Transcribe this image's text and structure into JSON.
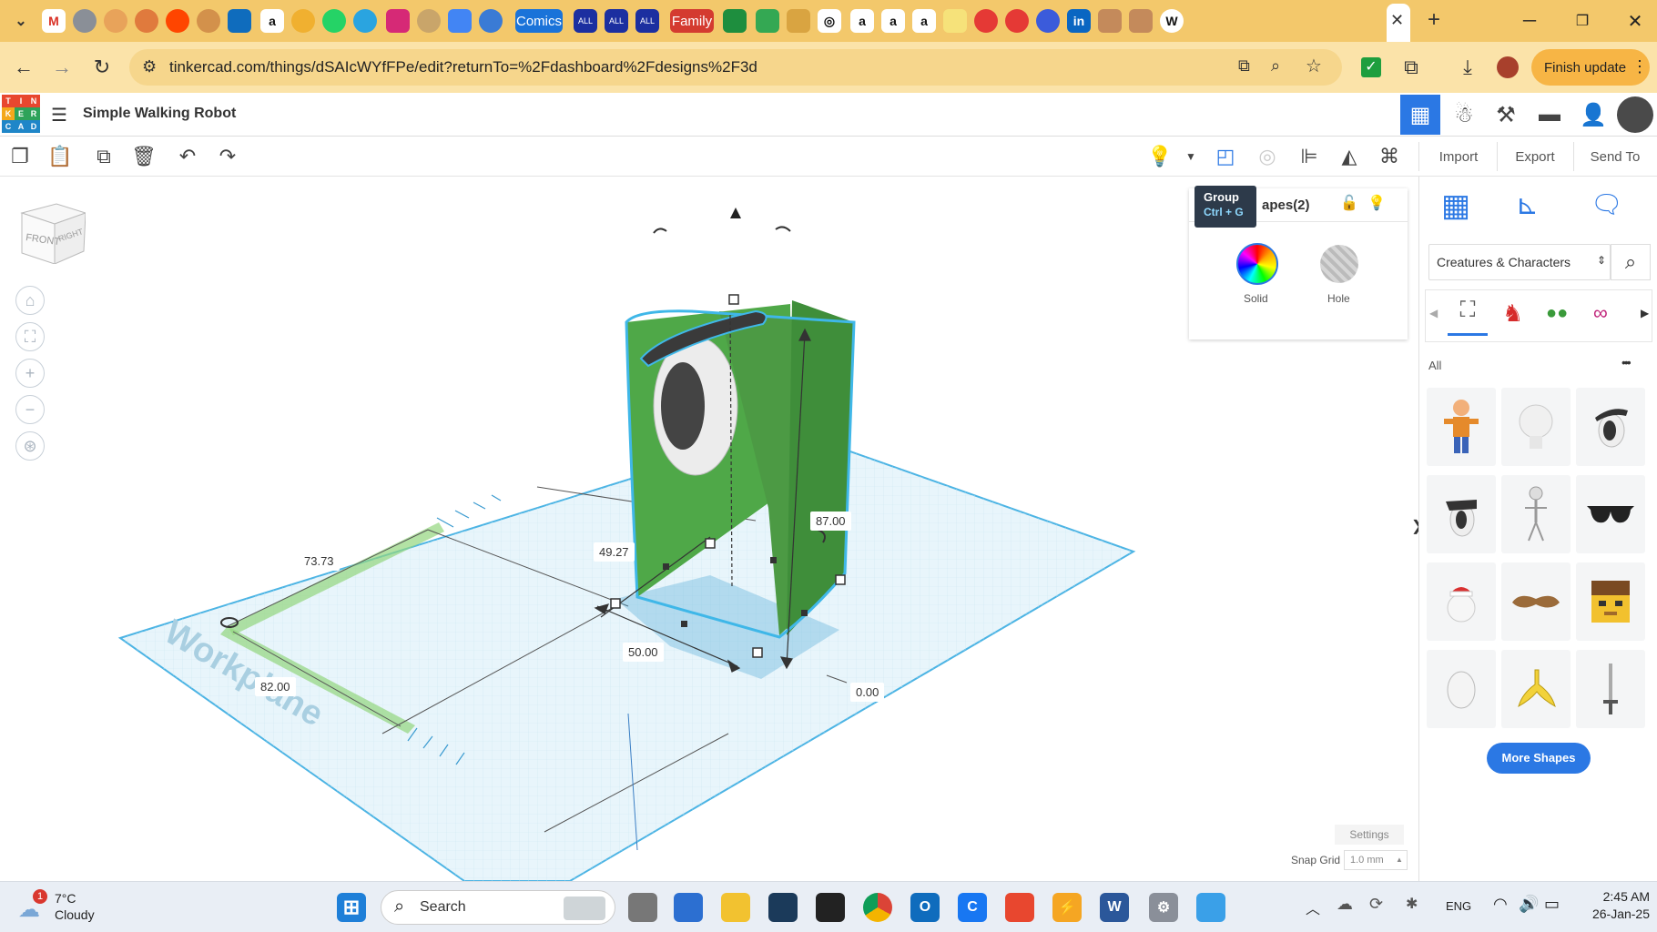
{
  "browser": {
    "tab_labels": [
      "Comics",
      "ALL",
      "ALL",
      "ALL",
      "Family"
    ],
    "url": "tinkercad.com/things/dSAIcWYfFPe/edit?returnTo=%2Fdashboard%2Fdesigns%2F3d",
    "finish_update": "Finish update",
    "menu_dots": "⋮"
  },
  "app": {
    "logo_letters": [
      "T",
      "I",
      "N",
      "K",
      "E",
      "R",
      "C",
      "A",
      "D"
    ],
    "design_title": "Simple Walking Robot"
  },
  "toolbar": {
    "import": "Import",
    "export": "Export",
    "send_to": "Send To"
  },
  "tooltip": {
    "title": "Group",
    "shortcut": "Ctrl + G"
  },
  "inspector": {
    "title": "Shapes(2)",
    "title_visible_part": "apes(2)",
    "solid": "Solid",
    "hole": "Hole"
  },
  "viewcube": {
    "front": "FRONT",
    "right": "RIGHT"
  },
  "workplane": {
    "watermark": "Workplane"
  },
  "dimensions": {
    "width_x": "73.73",
    "depth": "49.27",
    "height": "87.00",
    "length": "50.00",
    "y_offset": "82.00",
    "elevation": "0.00"
  },
  "sidebar": {
    "category": "Creatures & Characters",
    "filter_all": "All",
    "more_dots": "•••",
    "more_shapes": "More Shapes",
    "collapse": "❯"
  },
  "bottom": {
    "settings": "Settings",
    "snap_label": "Snap Grid",
    "snap_value": "1.0 mm"
  },
  "taskbar": {
    "weather_temp": "7°C",
    "weather_text": "Cloudy",
    "weather_badge": "1",
    "search": "Search",
    "lang": "ENG",
    "time": "2:45 AM",
    "date": "26-Jan-25"
  },
  "colors": {
    "tabstrip": "#f3c86b",
    "accent_blue": "#1a73d9",
    "shape_green": "#4fa848",
    "selection": "#3fb7e8"
  }
}
